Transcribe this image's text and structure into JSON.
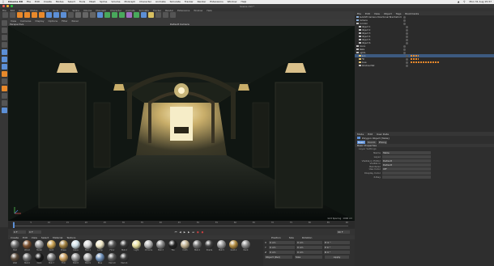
{
  "menubar": {
    "apple": "",
    "items": [
      "Cinema 4D",
      "File",
      "Edit",
      "Create",
      "Modes",
      "Select",
      "Tools",
      "Mesh",
      "Spline",
      "Volume",
      "MoGraph",
      "Character",
      "Animate",
      "Simulate",
      "Tracker",
      "Render",
      "Extensions",
      "Window",
      "Help"
    ],
    "clock": "Mon 31 Aug 15:37"
  },
  "window": {
    "title": "Scene.c4d *"
  },
  "app_menu": [
    "File",
    "Edit",
    "Create",
    "Modes",
    "Select",
    "Tools",
    "Mesh",
    "Spline",
    "Volume",
    "MoGraph",
    "Character",
    "Animate",
    "Simulate",
    "Tracker",
    "Render",
    "Extensions",
    "Window",
    "Help"
  ],
  "viewport": {
    "menu": [
      "View",
      "Cameras",
      "Display",
      "Options",
      "Filter",
      "Panel"
    ],
    "label": "Perspective",
    "camera": "Default Camera",
    "grid_spacing": "Grid Spacing : 1000 cm"
  },
  "transport": {
    "frame_start": "0 F",
    "frame_end": "90 F",
    "current": "0 F"
  },
  "timeline_ticks": [
    "0",
    "5",
    "10",
    "15",
    "20",
    "25",
    "30",
    "35",
    "40",
    "45",
    "50",
    "55",
    "60",
    "65",
    "70",
    "75",
    "80",
    "85",
    "90"
  ],
  "materials": {
    "menu": [
      "Create",
      "Edit",
      "View",
      "Select",
      "Material",
      "Texture"
    ],
    "items": [
      {
        "label": "Mat",
        "color": "#6b6b6b"
      },
      {
        "label": "Wood",
        "color": "#7a5030"
      },
      {
        "label": "Metal",
        "color": "#9b9b9b"
      },
      {
        "label": "Gold",
        "color": "#c8a050"
      },
      {
        "label": "Brass",
        "color": "#a08040"
      },
      {
        "label": "Glass",
        "color": "#cfe0e8"
      },
      {
        "label": "Mat.1",
        "color": "#d8d8d8"
      },
      {
        "label": "Lamp",
        "color": "#f0e8c8"
      },
      {
        "label": "Floor",
        "color": "#555555"
      },
      {
        "label": "Mat.2",
        "color": "#3a3a3a"
      },
      {
        "label": "Light",
        "color": "#e8e0a0"
      },
      {
        "label": "Chrome",
        "color": "#b8b8b8"
      },
      {
        "label": "Mat.3",
        "color": "#888888"
      },
      {
        "label": "Tile",
        "color": "#222222"
      },
      {
        "label": "Cloth",
        "color": "#c0b090"
      },
      {
        "label": "Mat.4",
        "color": "#707070"
      },
      {
        "label": "Shade",
        "color": "#404040"
      },
      {
        "label": "Mat.5",
        "color": "#989898"
      },
      {
        "label": "Gold.1",
        "color": "#b08a40"
      },
      {
        "label": "Paint",
        "color": "#8a8a8a"
      },
      {
        "label": "Wall",
        "color": "#5a4a3a"
      },
      {
        "label": "Mat.6",
        "color": "#6a6a6a"
      },
      {
        "label": "Dark",
        "color": "#1a1a1a"
      },
      {
        "label": "Mat.7",
        "color": "#7a7a7a"
      },
      {
        "label": "Trim",
        "color": "#caa060"
      },
      {
        "label": "Mat.8",
        "color": "#909090"
      },
      {
        "label": "Mat.9",
        "color": "#a8a8a8"
      },
      {
        "label": "Blue",
        "color": "#6e8fb8"
      },
      {
        "label": "Mat.10",
        "color": "#585858"
      },
      {
        "label": "Mat.11",
        "color": "#3c3c3c"
      }
    ]
  },
  "coordinates": {
    "headers": [
      "Position",
      "Size",
      "Rotation"
    ],
    "rows": [
      {
        "axis": "X",
        "pos": "0 cm",
        "size": "0 cm",
        "rot": "H 0 °"
      },
      {
        "axis": "Y",
        "pos": "0 cm",
        "size": "0 cm",
        "rot": "P 0 °"
      },
      {
        "axis": "Z",
        "pos": "0 cm",
        "size": "0 cm",
        "rot": "B 0 °"
      }
    ],
    "mode": "Object (Rel)",
    "size_mode": "Size",
    "apply": "Apply"
  },
  "object_manager": {
    "menu": [
      "File",
      "Edit",
      "View",
      "Object",
      "Tags",
      "Bookmarks"
    ],
    "objects": [
      {
        "name": "Redshift Camera Directional Brachistrome",
        "indent": 0,
        "color": "#8fb0d8"
      },
      {
        "name": "Camera",
        "indent": 0,
        "color": "#8fb0d8"
      },
      {
        "name": "Corridor",
        "indent": 0,
        "color": "#c0c0c0"
      },
      {
        "name": "Object 1",
        "indent": 1,
        "color": "#c0c0c0"
      },
      {
        "name": "Object 2",
        "indent": 1,
        "color": "#c0c0c0"
      },
      {
        "name": "Object 3",
        "indent": 1,
        "color": "#c0c0c0"
      },
      {
        "name": "Object 4",
        "indent": 1,
        "color": "#c0c0c0"
      },
      {
        "name": "Object 5",
        "indent": 1,
        "color": "#c0c0c0"
      },
      {
        "name": "Object 6",
        "indent": 1,
        "color": "#c0c0c0"
      },
      {
        "name": "Doors",
        "indent": 0,
        "color": "#c0c0c0"
      },
      {
        "name": "Walls",
        "indent": 0,
        "color": "#c0c0c0"
      },
      {
        "name": "Lights",
        "indent": 0,
        "color": "#c0c0c0"
      },
      {
        "name": "Sun",
        "indent": 1,
        "color": "#e0c070"
      },
      {
        "name": "Fill",
        "indent": 1,
        "color": "#e0c070"
      },
      {
        "name": "Area",
        "indent": 1,
        "color": "#e0c070"
      },
      {
        "name": "Window Mat",
        "indent": 1,
        "color": "#c0c0c0"
      }
    ]
  },
  "attribute_manager": {
    "menu": [
      "Mode",
      "Edit",
      "User Data"
    ],
    "object_title": "Polygon Object [Table]",
    "tabs": [
      "Basic",
      "Coord.",
      "Phong"
    ],
    "section": "Basic Properties",
    "layer_section": "Layer Settings",
    "fields": [
      {
        "label": "Name",
        "value": "Table"
      },
      {
        "label": "Layer",
        "value": ""
      },
      {
        "label": "Visible in Editor",
        "value": "Default"
      },
      {
        "label": "Visible in Renderer",
        "value": "Default"
      },
      {
        "label": "Use Color",
        "value": "Off"
      },
      {
        "label": "Display Color",
        "value": ""
      },
      {
        "label": "X-Ray",
        "value": ""
      }
    ]
  },
  "colors": {
    "accent": "#5c8fd6",
    "orange": "#e8892b",
    "highlight": "#3d5a80"
  }
}
